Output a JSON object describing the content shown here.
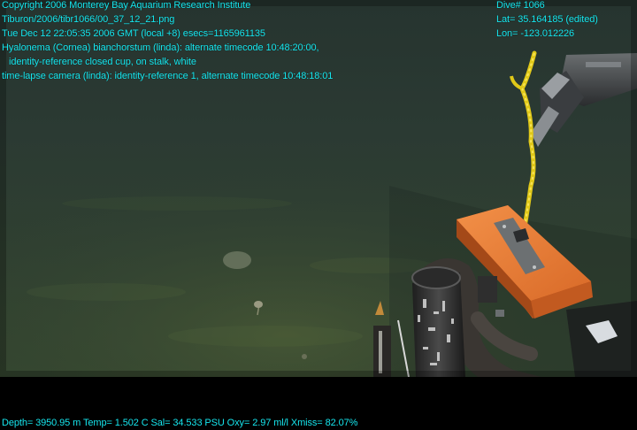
{
  "overlay": {
    "left_lines": [
      "Copyright 2006 Monterey Bay Aquarium Research Institute",
      "Tiburon/2006/tibr1066/00_37_12_21.png",
      "Tue Dec 12 22:05:35 2006 GMT (local +8)  esecs=1165961135",
      "Hyalonema (Cornea) bianchorstum (linda): alternate timecode 10:48:20:00,",
      "identity-reference closed cup, on stalk, white",
      "time-lapse camera (linda): identity-reference 1, alternate timecode 10:48:18:01"
    ],
    "right_lines": [
      "Dive# 1066",
      "Lat= 35.164185 (edited)",
      "Lon= -123.012226"
    ],
    "bottom_line": "Depth= 3950.95 m  Temp= 1.502 C  Sal= 34.533 PSU  Oxy= 2.97 ml/l  Xmiss= 82.07%"
  },
  "colors": {
    "overlay_text": "#16e6ee",
    "seafloor": "#2e3f2a",
    "water": "#2a3a36",
    "float": "#e87830",
    "rope": "#e8d020"
  }
}
